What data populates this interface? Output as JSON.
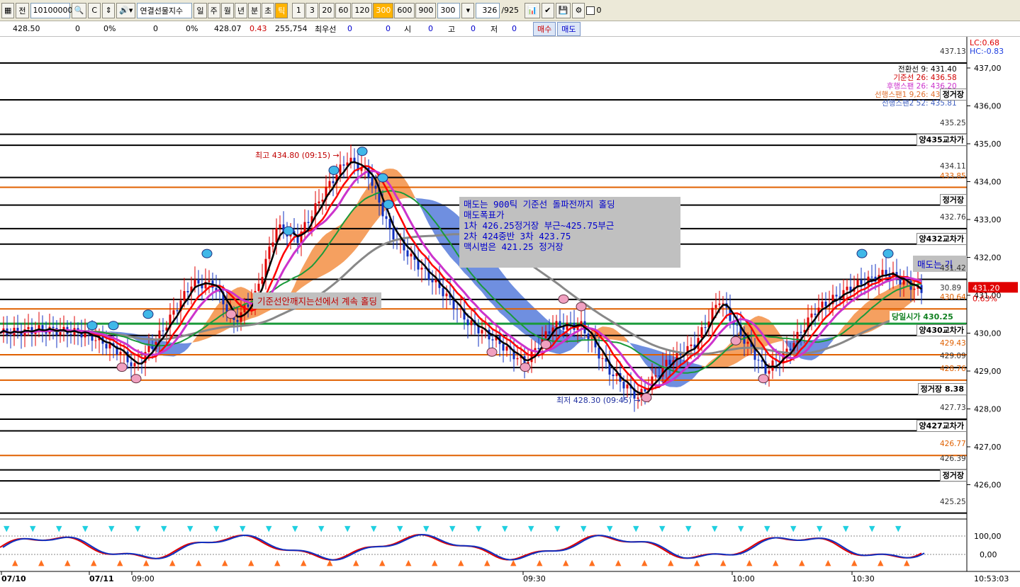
{
  "toolbar": {
    "prefix": "전",
    "code": "10100000",
    "name": "연결선물지수",
    "periods": [
      "일",
      "주",
      "월",
      "년",
      "분",
      "초",
      "틱"
    ],
    "active_period": "틱",
    "ticks": [
      "1",
      "3",
      "20",
      "60",
      "120",
      "300",
      "600",
      "900"
    ],
    "active_tick": "300",
    "tick_value": "300",
    "count": "326",
    "total": "/925",
    "checkbox_value": "0"
  },
  "infobar": {
    "v1": "428.50",
    "v2": "0",
    "v3": "0%",
    "v4": "0",
    "v5": "0%",
    "price": "428.07",
    "change": "0.43",
    "volume": "255,754",
    "best_label": "최우선",
    "best1": "0",
    "best2": "0",
    "open_label": "시",
    "open": "0",
    "high_label": "고",
    "high": "0",
    "low_label": "저",
    "low": "0",
    "buy": "매수",
    "sell": "매도"
  },
  "price_axis": {
    "labels": [
      "437,00",
      "436,00",
      "435,00",
      "434,00",
      "433,00",
      "432,00",
      "431,00",
      "430,00",
      "429,00",
      "428,00",
      "427,00",
      "426,00"
    ],
    "lc": "LC:0.68",
    "hc": "HC:-0.83",
    "current": "431.20",
    "current_pct": "0.63%",
    "osc_labels": [
      "100,00",
      "0,00"
    ]
  },
  "time_axis": {
    "labels": [
      "07/10",
      "07/11",
      "09:00",
      "09:30",
      "10:00",
      "10:30"
    ],
    "clock": "10:53:03"
  },
  "levels": [
    {
      "y": 437.13,
      "label": "437.13",
      "color": "#000000"
    },
    {
      "y": 436.16,
      "label": "정거장",
      "color": "#000000",
      "tag": true
    },
    {
      "y": 435.25,
      "label": "435.25",
      "color": "#000000"
    },
    {
      "y": 434.96,
      "label": "양435교차가",
      "color": "#000000",
      "tag": true
    },
    {
      "y": 434.11,
      "label": "434.11",
      "color": "#000000"
    },
    {
      "y": 433.85,
      "label": "433.85",
      "color": "#e06000"
    },
    {
      "y": 433.38,
      "label": "정거장",
      "color": "#000000",
      "tag": true
    },
    {
      "y": 432.76,
      "label": "432.76",
      "color": "#000000"
    },
    {
      "y": 432.35,
      "label": "양432교차가",
      "color": "#000000",
      "tag": true
    },
    {
      "y": 431.42,
      "label": "431.42",
      "color": "#000000"
    },
    {
      "y": 430.89,
      "label": "30.89",
      "color": "#000000"
    },
    {
      "y": 430.64,
      "label": "430.64",
      "color": "#e06000"
    },
    {
      "y": 429.94,
      "label": "양430교차가",
      "color": "#000000",
      "tag": true
    },
    {
      "y": 429.43,
      "label": "429.43",
      "color": "#e06000"
    },
    {
      "y": 429.09,
      "label": "429.09",
      "color": "#000000"
    },
    {
      "y": 428.76,
      "label": "428.76",
      "color": "#e06000"
    },
    {
      "y": 428.38,
      "label": "정거장 8.38",
      "color": "#000000",
      "tag": true
    },
    {
      "y": 427.73,
      "label": "427.73",
      "color": "#000000"
    },
    {
      "y": 427.42,
      "label": "양427교차가",
      "color": "#000000",
      "tag": true
    },
    {
      "y": 426.77,
      "label": "426.77",
      "color": "#e06000"
    },
    {
      "y": 426.39,
      "label": "426.39",
      "color": "#000000"
    },
    {
      "y": 426.1,
      "label": "정거장",
      "color": "#000000",
      "tag": true
    },
    {
      "y": 425.25,
      "label": "425.25",
      "color": "#000000"
    }
  ],
  "legend": {
    "l1": "전환선 9: 431.40",
    "l2": "기준선 26: 436.58",
    "l3": "후행스팬 26: 436.20",
    "l4": "선행스팬1 9,26: 436.02",
    "l5": "선행스팬2 52: 435.81"
  },
  "annotations": {
    "high": "최고 434.80 (09:15) →",
    "low": "최저 428.30 (09:45) →",
    "hold": "기준선안깨지는선에서 계속 홀딩",
    "sell_tag": "매도는 기",
    "day_open": "당일시가 430.25"
  },
  "note": [
    "매도는 900틱 기준선 돌파전까지 홀딩",
    "매도폭표가",
    "1차 426.25정거장 부근~425.75부근",
    "2차 424중반  3차 423.75",
    "맥시범은 421.25 정거장"
  ],
  "colors": {
    "conversion": "#000000",
    "base": "#ff0000",
    "lagging": "#cc33cc",
    "span_up": "#f5a060",
    "span_down": "#6f8fe0",
    "ma_green": "#1a9a3a",
    "ma_gray": "#888888",
    "candle_up": "#e00000",
    "candle_down": "#1030c0"
  }
}
